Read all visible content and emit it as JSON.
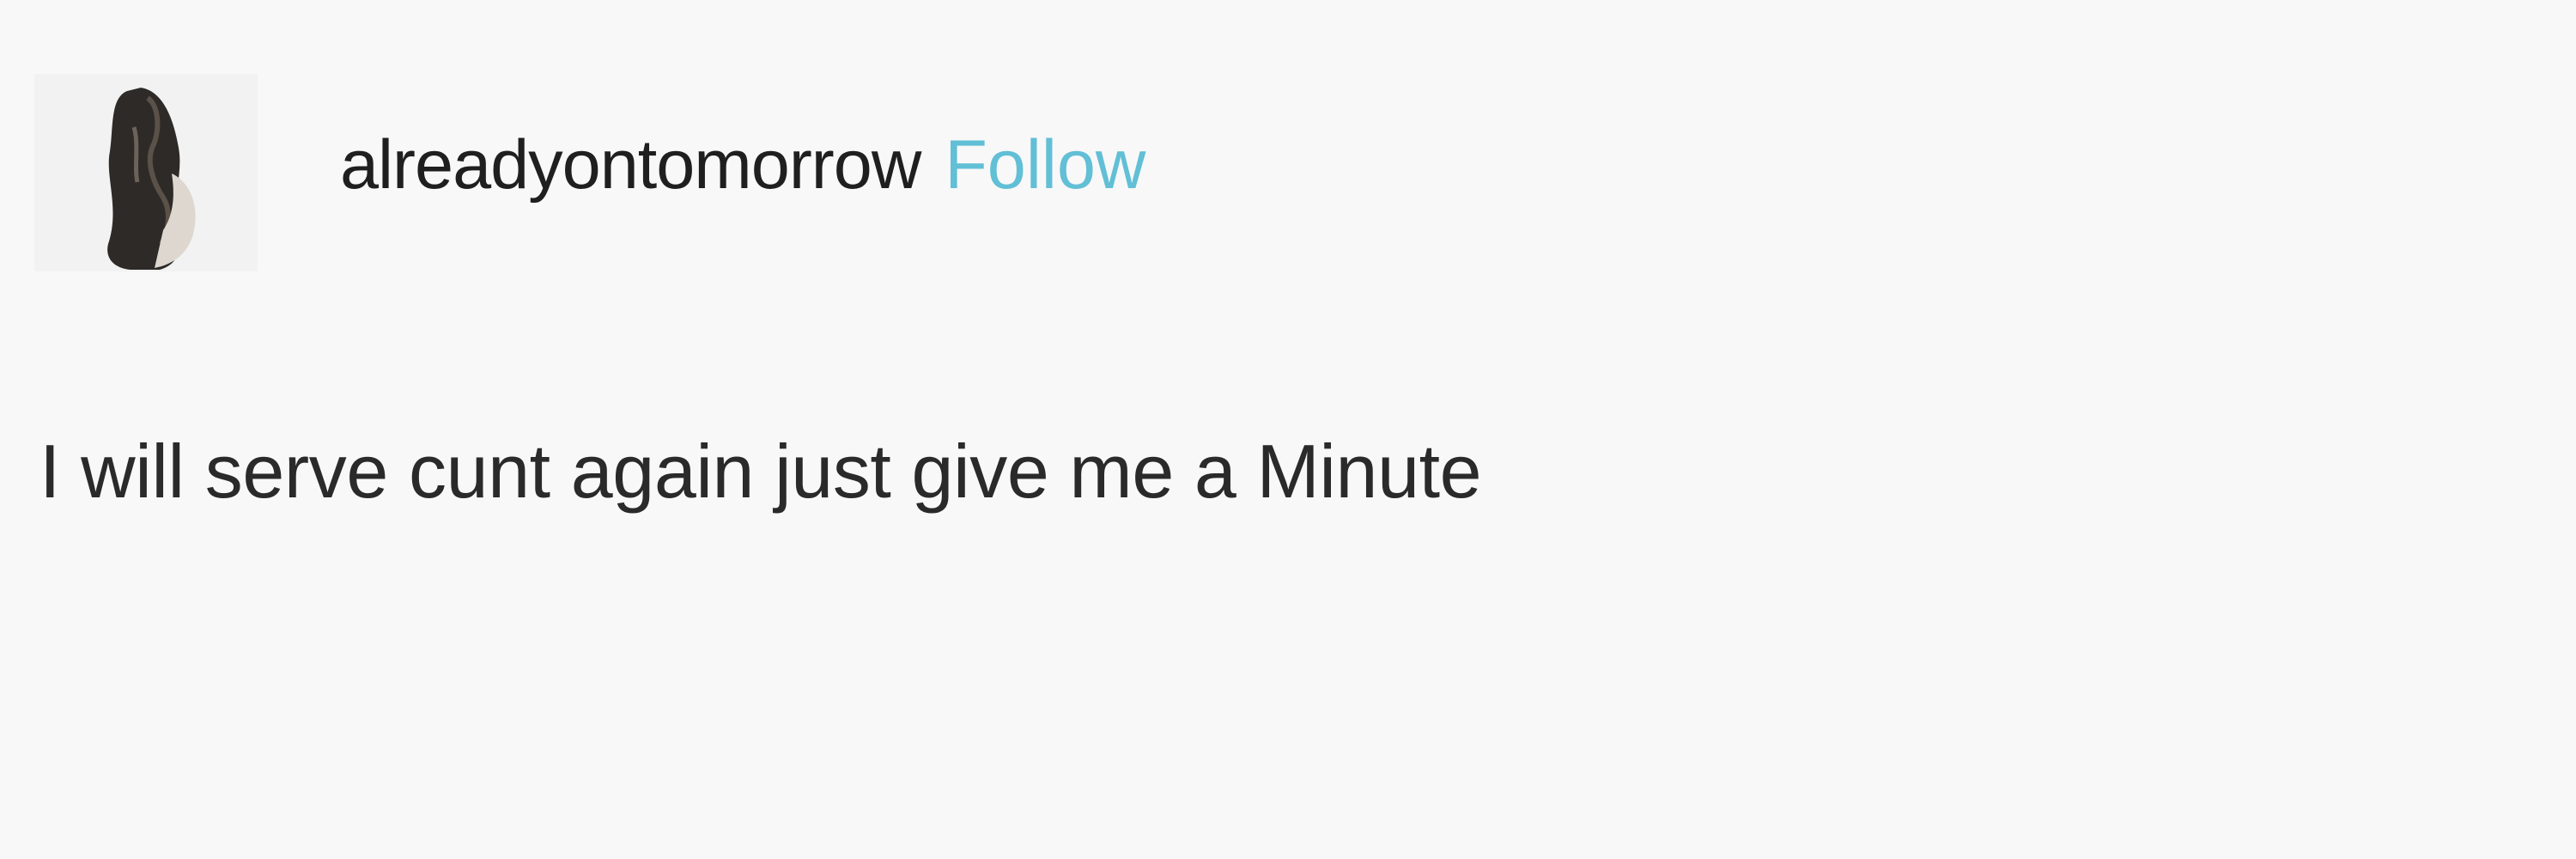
{
  "post": {
    "author": {
      "username": "alreadyontomorrow",
      "follow_label": "Follow",
      "avatar_icon": "avatar-photo"
    },
    "body_text": "I will serve cunt again just give me a Minute"
  },
  "colors": {
    "background": "#f8f8f8",
    "text": "#1f1f1f",
    "follow": "#61bfd6"
  }
}
